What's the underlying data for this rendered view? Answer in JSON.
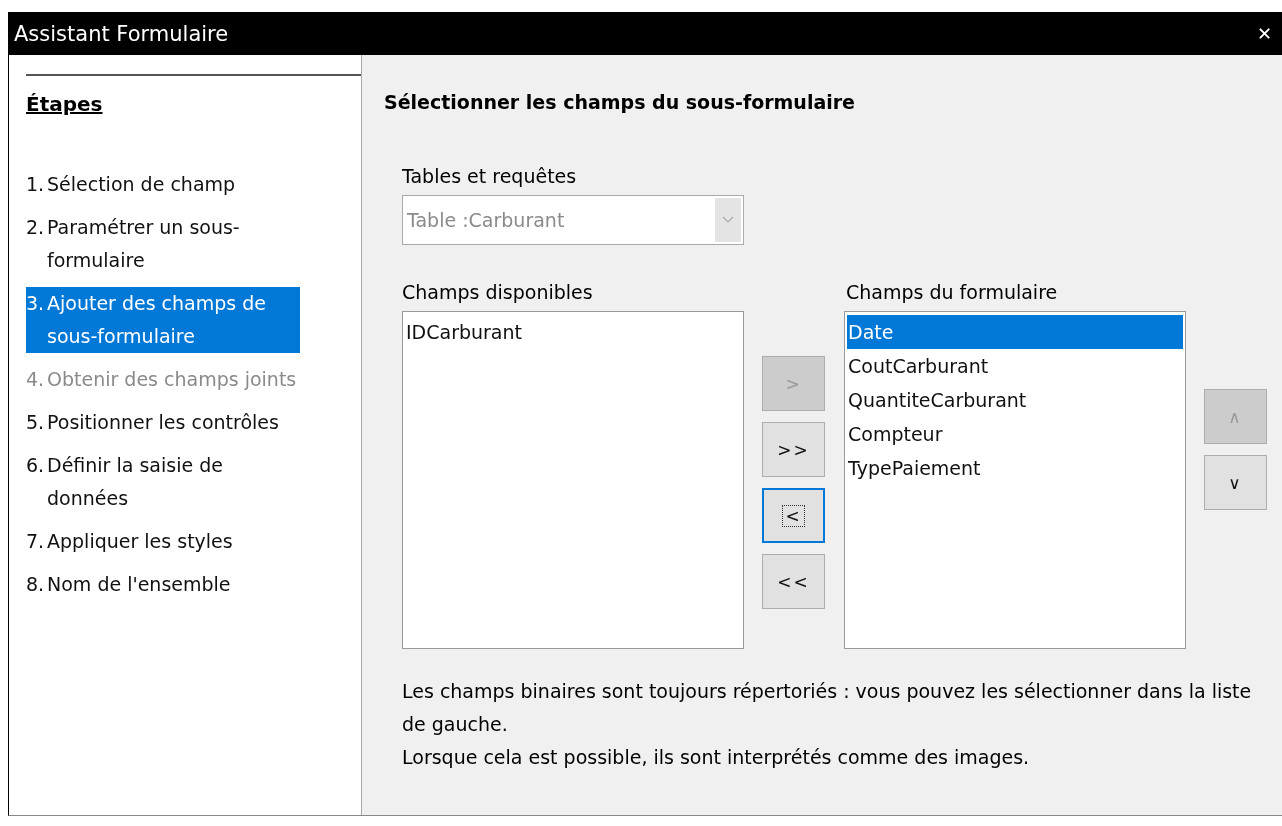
{
  "window": {
    "title": "Assistant Formulaire",
    "close": "✕"
  },
  "steps": {
    "heading": "Étapes",
    "items": [
      {
        "number": "1.",
        "label": "Sélection de champ",
        "selected": false,
        "disabled": false
      },
      {
        "number": "2.",
        "label": "Paramétrer un sous-formulaire",
        "selected": false,
        "disabled": false
      },
      {
        "number": "3.",
        "label": "Ajouter des champs de sous-formulaire",
        "selected": true,
        "disabled": false
      },
      {
        "number": "4.",
        "label": "Obtenir des champs joints",
        "selected": false,
        "disabled": true
      },
      {
        "number": "5.",
        "label": "Positionner les contrôles",
        "selected": false,
        "disabled": false
      },
      {
        "number": "6.",
        "label": "Définir la saisie de données",
        "selected": false,
        "disabled": false
      },
      {
        "number": "7.",
        "label": "Appliquer les styles",
        "selected": false,
        "disabled": false
      },
      {
        "number": "8.",
        "label": "Nom de l'ensemble",
        "selected": false,
        "disabled": false
      }
    ]
  },
  "page": {
    "title": "Sélectionner les champs du sous-formulaire",
    "tables": {
      "label": "Tables et requêtes",
      "value": "Table :Carburant",
      "disabled": true
    },
    "available": {
      "label": "Champs disponibles",
      "items": [
        {
          "label": "IDCarburant",
          "selected": false
        }
      ]
    },
    "move_buttons": [
      {
        "label": ">",
        "disabled": true,
        "focused": false
      },
      {
        "label": ">>",
        "disabled": false,
        "focused": false
      },
      {
        "label": "<",
        "disabled": false,
        "focused": true
      },
      {
        "label": "<<",
        "disabled": false,
        "focused": false
      }
    ],
    "form_fields": {
      "label": "Champs du formulaire",
      "items": [
        {
          "label": "Date",
          "selected": true
        },
        {
          "label": "CoutCarburant",
          "selected": false
        },
        {
          "label": "QuantiteCarburant",
          "selected": false
        },
        {
          "label": "Compteur",
          "selected": false
        },
        {
          "label": "TypePaiement",
          "selected": false
        }
      ]
    },
    "order_buttons": [
      {
        "label": "∧",
        "disabled": true
      },
      {
        "label": "∨",
        "disabled": false
      }
    ],
    "note": [
      "Les champs binaires sont toujours répertoriés : vous pouvez les sélectionner dans la liste de gauche.",
      "Lorsque cela est possible, ils sont interprétés comme des images."
    ]
  }
}
